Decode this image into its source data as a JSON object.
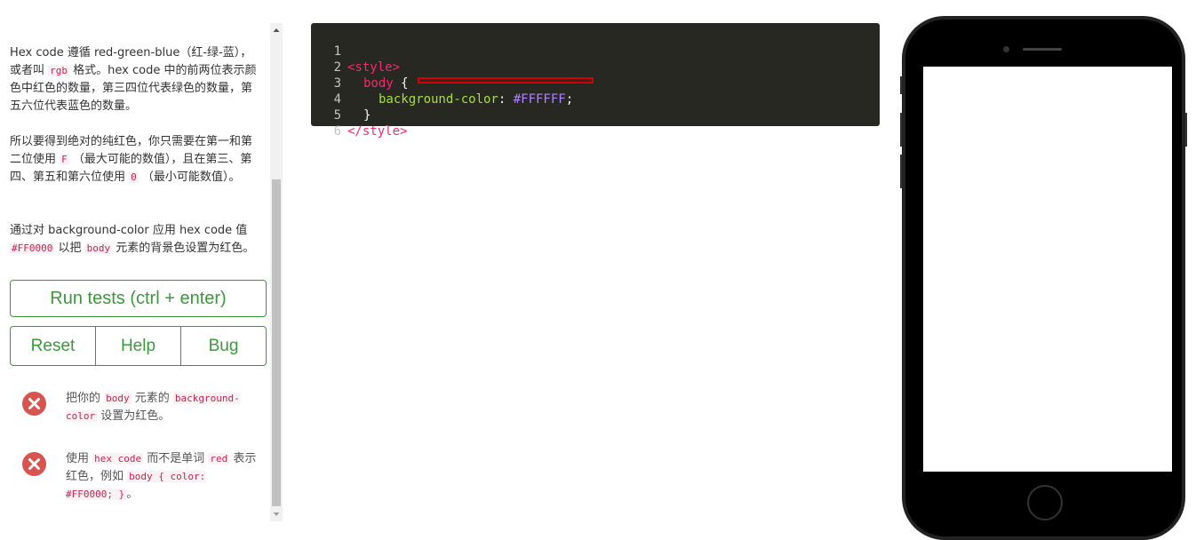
{
  "instructions": {
    "p1": {
      "a": "Hex code 遵循 red-green-blue（红-绿-蓝），或者叫 ",
      "code1": "rgb",
      "b": " 格式。hex code 中的前两位表示颜色中红色的数量，第三四位代表绿色的数量，第五六位代表蓝色的数量。"
    },
    "p2": {
      "a": "所以要得到绝对的纯红色，你只需要在第一和第二位使用 ",
      "code1": "F",
      "b": " （最大可能的数值），且在第三、第四、第五和第六位使用 ",
      "code2": "0",
      "c": " （最小可能数值）。"
    },
    "p3": {
      "a": "通过对 background-color 应用 hex code 值 ",
      "code1": "#FF0000",
      "b": " 以把 ",
      "code2": "body",
      "c": " 元素的背景色设置为红色。"
    }
  },
  "buttons": {
    "run": "Run tests (ctrl + enter)",
    "reset": "Reset",
    "help": "Help",
    "bug": "Bug"
  },
  "tests": [
    {
      "status": "fail",
      "a": "把你的 ",
      "code1": "body",
      "b": " 元素的 ",
      "code2": "background-color",
      "c": " 设置为红色。"
    },
    {
      "status": "fail",
      "a": "使用 ",
      "code1": "hex code",
      "b": " 而不是单词 ",
      "code2": "red",
      "c": " 表示红色，例如 ",
      "code3": "body { color: #FF0000; }",
      "d": "。"
    }
  ],
  "editor": {
    "lines": [
      {
        "n": "1",
        "tag": "<style>"
      },
      {
        "n": "2",
        "sel": "body",
        "brace": " {"
      },
      {
        "n": "3",
        "prop": "background-color",
        "colon": ": ",
        "val": "#FFFFFF",
        "semi": ";"
      },
      {
        "n": "4",
        "brace": "}"
      },
      {
        "n": "5",
        "tag": "</style>"
      },
      {
        "n": "6"
      }
    ]
  },
  "colors": {
    "accent_green": "#3a9a3a",
    "fail_red": "#d9534f",
    "editor_bg": "#272822",
    "preview_bg": "#FFFFFF"
  }
}
